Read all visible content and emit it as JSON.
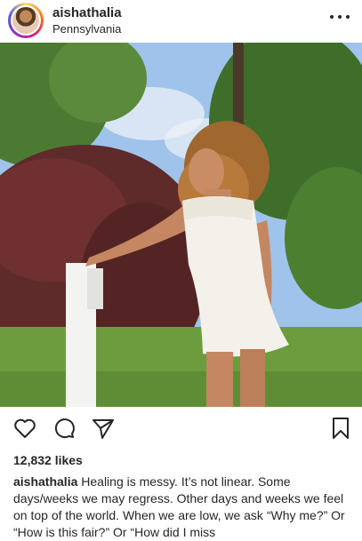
{
  "post": {
    "username": "aishathalia",
    "location": "Pennsylvania",
    "likes": "12,832 likes",
    "caption_user": "aishathalia",
    "caption_text": "Healing is messy. It’s not linear. Some days/weeks we may regress. Other days and weeks we feel on top of the world. When we are low, we ask “Why me?” Or “How is this fair?” Or “How did I miss"
  },
  "icons": {
    "more": "more-options-icon",
    "like": "heart-icon",
    "comment": "comment-icon",
    "share": "paper-plane-icon",
    "save": "bookmark-icon"
  },
  "colors": {
    "text": "#262626",
    "background": "#ffffff"
  }
}
